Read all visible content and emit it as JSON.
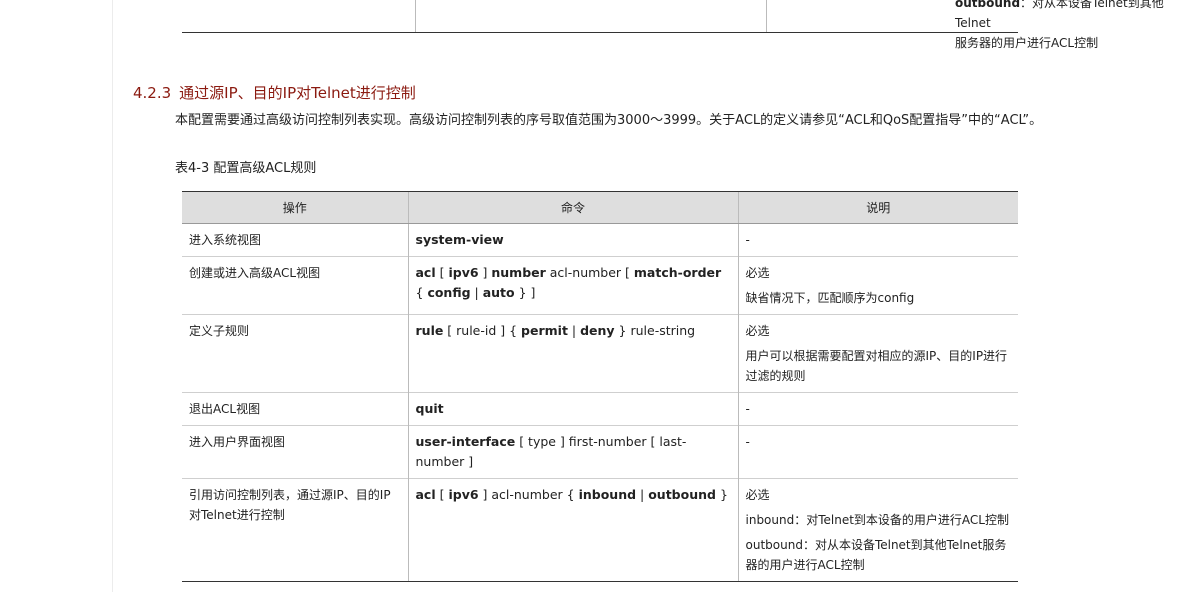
{
  "top_fragment": {
    "line1_keyword": "outbound",
    "line1_rest": "：对从本设备Telnet到其他Telnet",
    "line2": "服务器的用户进行ACL控制"
  },
  "section": {
    "number": "4.2.3",
    "title": "通过源IP、目的IP对Telnet进行控制"
  },
  "intro": "本配置需要通过高级访问控制列表实现。高级访问控制列表的序号取值范围为3000～3999。关于ACL的定义请参见“ACL和QoS配置指导”中的“ACL”。",
  "table_caption": "表4-3 配置高级ACL规则",
  "table": {
    "headers": [
      "操作",
      "命令",
      "说明"
    ],
    "rows": [
      {
        "op": "进入系统视图",
        "cmd": [
          {
            "b": "system-view"
          }
        ],
        "notes": [
          "-"
        ]
      },
      {
        "op": "创建或进入高级ACL视图",
        "cmd": [
          {
            "b": "acl"
          },
          {
            "t": " [ "
          },
          {
            "b": "ipv6"
          },
          {
            "t": " ] "
          },
          {
            "b": "number"
          },
          {
            "t": " acl-number [ "
          },
          {
            "b": "match-order"
          },
          {
            "t": " { "
          },
          {
            "b": "config"
          },
          {
            "t": " | "
          },
          {
            "b": "auto"
          },
          {
            "t": " } ]"
          }
        ],
        "notes": [
          "必选",
          "缺省情况下，匹配顺序为config"
        ]
      },
      {
        "op": "定义子规则",
        "cmd": [
          {
            "b": "rule"
          },
          {
            "t": " [ rule-id ] { "
          },
          {
            "b": "permit"
          },
          {
            "t": " | "
          },
          {
            "b": "deny"
          },
          {
            "t": " } rule-string"
          }
        ],
        "notes": [
          "必选",
          "用户可以根据需要配置对相应的源IP、目的IP进行过滤的规则"
        ]
      },
      {
        "op": "退出ACL视图",
        "cmd": [
          {
            "b": "quit"
          }
        ],
        "notes": [
          "-"
        ]
      },
      {
        "op": "进入用户界面视图",
        "cmd": [
          {
            "b": "user-interface"
          },
          {
            "t": " [ type ] first-number [ last-number ]"
          }
        ],
        "notes": [
          "-"
        ]
      },
      {
        "op": "引用访问控制列表，通过源IP、目的IP对Telnet进行控制",
        "cmd": [
          {
            "b": "acl"
          },
          {
            "t": " [ "
          },
          {
            "b": "ipv6"
          },
          {
            "t": " ] acl-number { "
          },
          {
            "b": "inbound"
          },
          {
            "t": " | "
          },
          {
            "b": "outbound"
          },
          {
            "t": " }"
          }
        ],
        "notes": [
          "必选",
          "inbound：对Telnet到本设备的用户进行ACL控制",
          "outbound：对从本设备Telnet到其他Telnet服务器的用户进行ACL控制"
        ]
      }
    ]
  }
}
